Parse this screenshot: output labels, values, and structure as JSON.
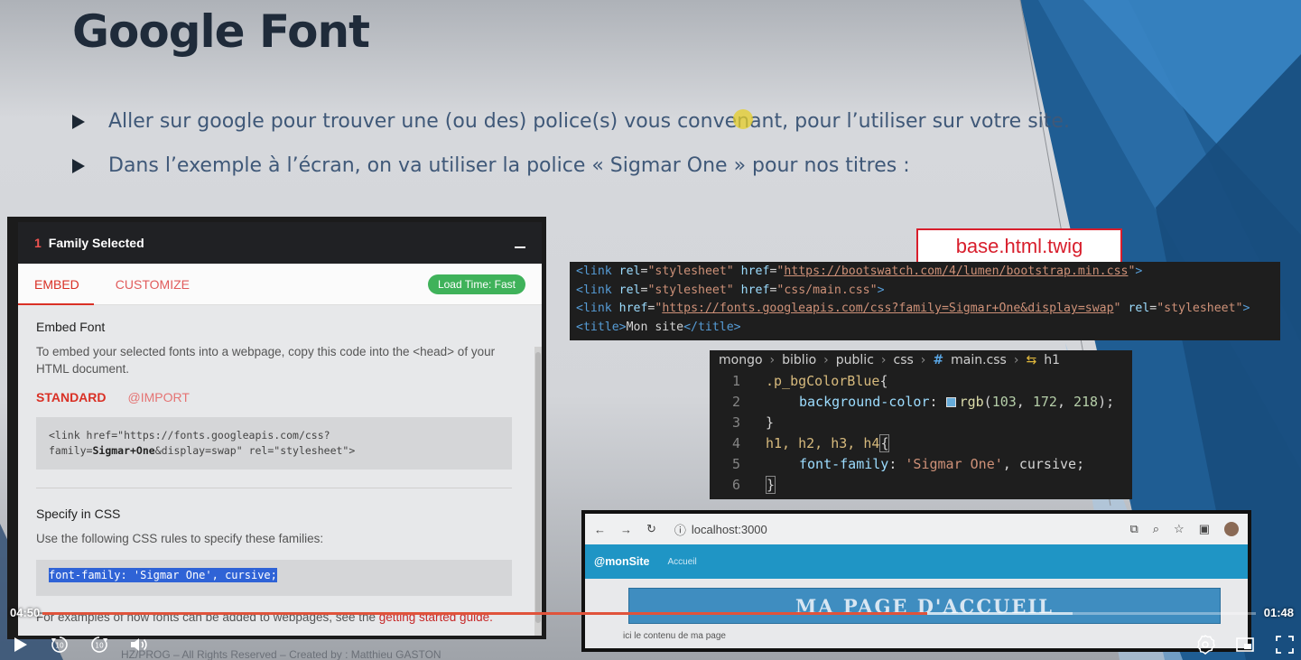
{
  "slide": {
    "title": "Google Font",
    "bullets": [
      "Aller sur google pour trouver une (ou des) police(s) vous convenant, pour l’utiliser sur votre site.",
      "Dans l’exemple à l’écran, on va utiliser la police «  Sigmar One » pour nos titres :"
    ],
    "file_label": "base.html.twig",
    "footer_faint": "HZ/PROG – All Rights Reserved – Created by : Matthieu GASTON"
  },
  "google_fonts_panel": {
    "count": "1",
    "header": "Family Selected",
    "tabs": [
      "EMBED",
      "CUSTOMIZE"
    ],
    "load_time": "Load Time: Fast",
    "embed_heading": "Embed Font",
    "embed_text": "To embed your selected fonts into a webpage, copy this code into the <head> of your HTML document.",
    "sub_tabs": [
      "STANDARD",
      "@IMPORT"
    ],
    "code_pre": "<link href=\"https://fonts.googleapis.com/css?family=",
    "code_bold": "Sigmar+One",
    "code_post": "&display=swap\" rel=\"stylesheet\">",
    "css_heading": "Specify in CSS",
    "css_text": "Use the following CSS rules to specify these families:",
    "css_rule": "font-family: 'Sigmar One', cursive;",
    "foot_text": "For examples of how fonts can be added to webpages, see the ",
    "foot_link": "getting started guide."
  },
  "code_html": [
    {
      "href": "https://bootswatch.com/4/lumen/bootstrap.min.css"
    },
    {
      "href": "css/main.css"
    },
    {
      "href": "https://fonts.googleapis.com/css?family=Sigmar+One&display=swap"
    },
    {
      "title": "Mon site"
    }
  ],
  "code_css": {
    "breadcrumb": [
      "mongo",
      "biblio",
      "public",
      "css",
      "main.css",
      "h1"
    ],
    "breadcrumb_hash": "#",
    "line_numbers": [
      "1",
      "2",
      "3",
      "4",
      "5",
      "6"
    ],
    "selector1": ".p_bgColorBlue",
    "prop1": "background-color",
    "value1_fn": "rgb",
    "value1_args": [
      "103",
      "172",
      "218"
    ],
    "swatch_color": "#67acda",
    "selector2": "h1, h2, h3, h4",
    "prop2": "font-family",
    "value2_str": "'Sigmar One'",
    "value2_kw": "cursive"
  },
  "browser": {
    "url": "localhost:3000",
    "brand": "@monSite",
    "nav_home": "Accueil",
    "heading": "MA PAGE D'ACCUEIL",
    "content": "ici le contenu de ma page"
  },
  "video": {
    "current_time": "04:50",
    "remaining_time": "01:48",
    "progress_fraction": 0.729,
    "skip_seconds": "10"
  },
  "colors": {
    "accent_red": "#d93025",
    "load_badge": "#3fb25a",
    "progress": "#e0533b"
  }
}
